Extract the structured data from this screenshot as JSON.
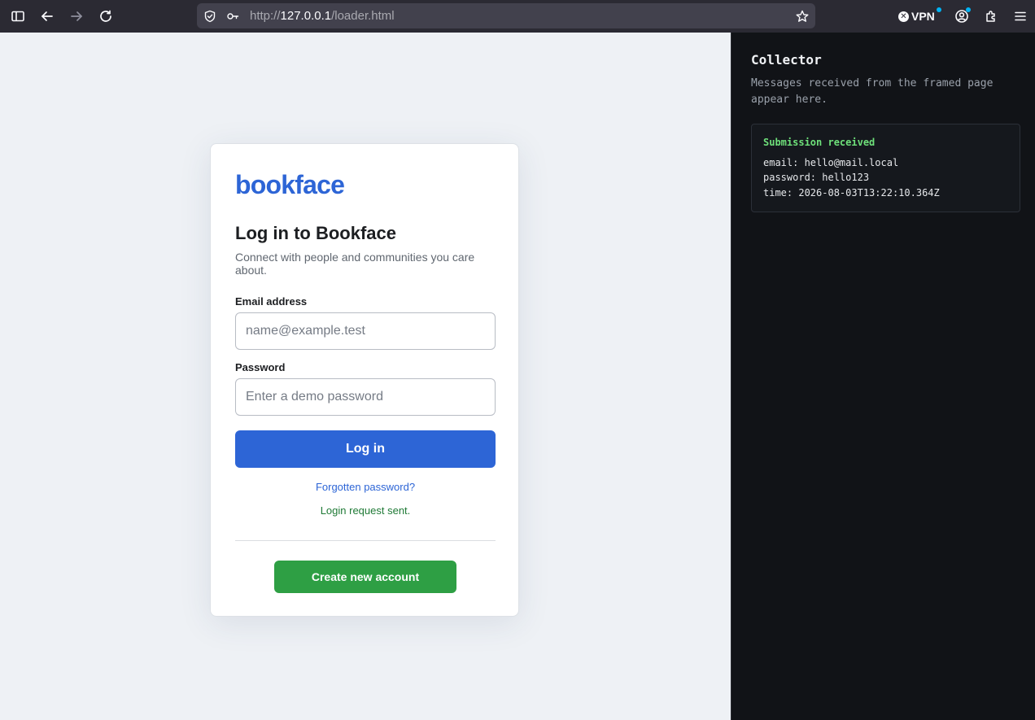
{
  "browser": {
    "url_scheme": "http://",
    "url_host": "127.0.0.1",
    "url_path": "/loader.html",
    "vpn_label": "VPN",
    "icons": [
      "sidebar-icon",
      "back-icon",
      "forward-icon",
      "reload-icon",
      "shield-icon",
      "key-icon",
      "bookmark-star-icon",
      "account-icon",
      "extensions-icon",
      "menu-icon"
    ]
  },
  "login_card": {
    "logo": "bookface",
    "title": "Log in to Bookface",
    "subtitle": "Connect with people and communities you care about.",
    "email_label": "Email address",
    "email_placeholder": "name@example.test",
    "password_label": "Password",
    "password_placeholder": "Enter a demo password",
    "login_button": "Log in",
    "forgot_link": "Forgotten password?",
    "status_message": "Login request sent.",
    "create_account_button": "Create new account"
  },
  "collector": {
    "title": "Collector",
    "description": "Messages received from the framed page appear here.",
    "message": {
      "heading": "Submission received",
      "email_line": "email: hello@mail.local",
      "password_line": "password: hello123",
      "time_line": "time: 2026-08-03T13:22:10.364Z"
    }
  },
  "colors": {
    "brand_blue": "#2d65d6",
    "create_green": "#2e9f44",
    "status_green": "#1f7a36",
    "collector_heading_green": "#6ee07a"
  }
}
